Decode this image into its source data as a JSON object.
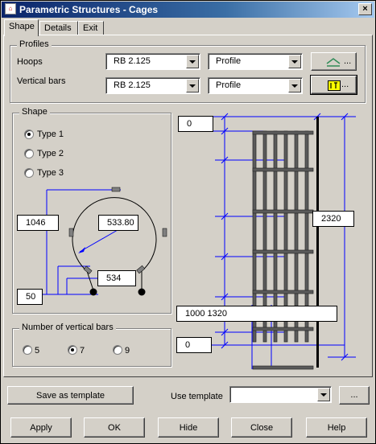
{
  "window": {
    "title": "Parametric Structures - Cages",
    "close_glyph": "×"
  },
  "tabs": [
    {
      "label": "Shape",
      "active": true
    },
    {
      "label": "Details",
      "active": false
    },
    {
      "label": "Exit",
      "active": false
    }
  ],
  "profiles": {
    "title": "Profiles",
    "hoops": {
      "label": "Hoops",
      "size": "RB 2.125",
      "type": "Profile",
      "button_label": "..."
    },
    "vertical_bars": {
      "label": "Vertical bars",
      "size": "RB 2.125",
      "type": "Profile",
      "button_label": "..."
    }
  },
  "shape": {
    "title": "Shape",
    "options": [
      {
        "label": "Type 1",
        "selected": true
      },
      {
        "label": "Type 2",
        "selected": false
      },
      {
        "label": "Type 3",
        "selected": false
      }
    ],
    "dims": {
      "height": "1046",
      "radius": "533.80",
      "gap": "534",
      "offset": "50"
    }
  },
  "vertical_count": {
    "title": "Number of vertical bars",
    "options": [
      {
        "label": "5",
        "selected": false
      },
      {
        "label": "7",
        "selected": true
      },
      {
        "label": "9",
        "selected": false
      }
    ]
  },
  "elevation": {
    "top": "0",
    "height": "2320",
    "spacing": "1000 1320",
    "bottom": "0"
  },
  "template": {
    "save_label": "Save as template",
    "use_label": "Use template",
    "value": "",
    "browse_label": "..."
  },
  "footer": {
    "apply": "Apply",
    "ok": "OK",
    "hide": "Hide",
    "close": "Close",
    "help": "Help"
  },
  "colors": {
    "dimension_line": "#0000ff",
    "bar": "#595959",
    "title_bar": "#0a246a"
  }
}
